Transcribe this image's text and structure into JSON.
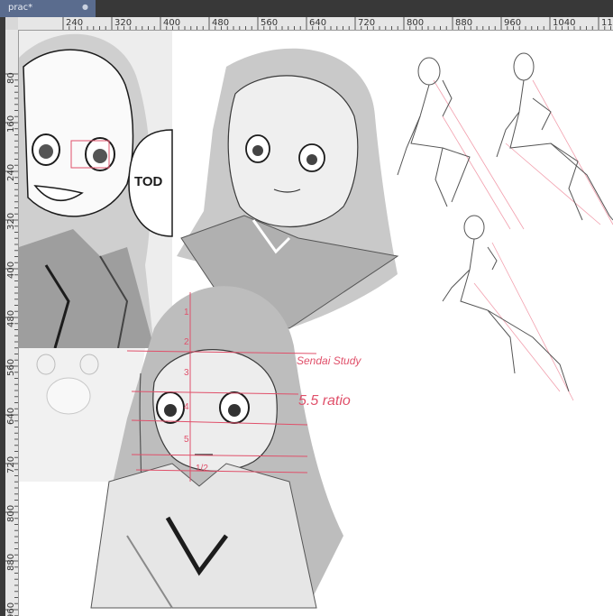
{
  "tab": {
    "title": "prac*",
    "close_glyph": "●"
  },
  "ruler": {
    "top_labels": [
      "240",
      "320",
      "400",
      "480",
      "560",
      "640",
      "720",
      "800",
      "880",
      "960",
      "1040",
      "11"
    ],
    "left_labels": [
      "80",
      "160",
      "240",
      "320",
      "400",
      "480",
      "560",
      "640",
      "720",
      "800",
      "880",
      "960"
    ]
  },
  "canvas": {
    "speech_bubble_text": "TOD",
    "annotation_study": "Sendai Study",
    "annotation_ratio": "5.5 ratio",
    "guide_numbers": [
      "1",
      "2",
      "3",
      "4",
      "5",
      "1/2"
    ],
    "ink_color": "#1c1c1c",
    "annotation_color": "#e0506a"
  }
}
